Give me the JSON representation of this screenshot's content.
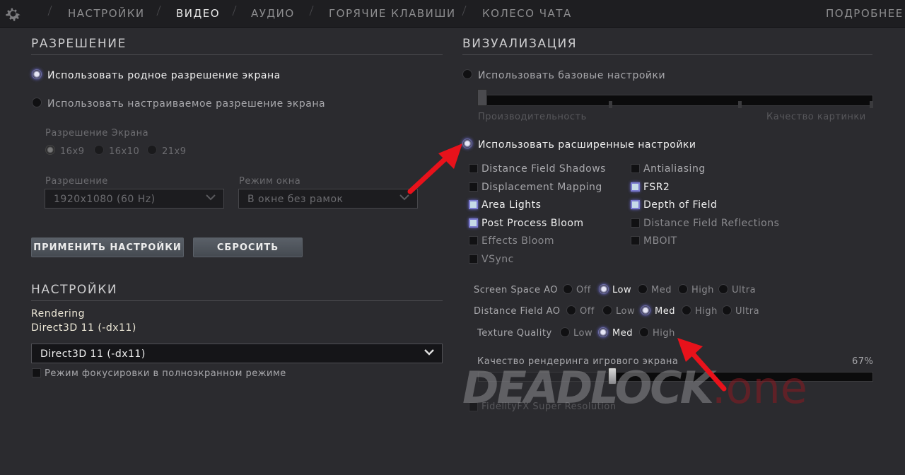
{
  "topbar": {
    "tabs": [
      "НАСТРОЙКИ",
      "ВИДЕО",
      "АУДИО",
      "ГОРЯЧИЕ КЛАВИШИ",
      "КОЛЕСО ЧАТА"
    ],
    "active_tab": "ВИДЕО",
    "more_label": "ПОДРОБНЕЕ"
  },
  "resolution": {
    "title": "РАЗРЕШЕНИЕ",
    "native_label": "Использовать родное разрешение экрана",
    "custom_label": "Использовать настраиваемое разрешение экрана",
    "aspect_label": "Разрешение Экрана",
    "aspects": [
      "16x9",
      "16x10",
      "21x9"
    ],
    "res_label": "Разрешение",
    "res_value": "1920x1080 (60 Hz)",
    "window_label": "Режим окна",
    "window_value": "В окне без рамок",
    "apply_button": "ПРИМЕНИТЬ НАСТРОЙКИ",
    "reset_button": "СБРОСИТЬ"
  },
  "settings": {
    "title": "НАСТРОЙКИ",
    "rendering_label": "Rendering",
    "rendering_value": "Direct3D 11 (-dx11)",
    "renderer_select": "Direct3D 11 (-dx11)",
    "focus_label": "Режим фокусировки в полноэкранном режиме"
  },
  "visualization": {
    "title": "ВИЗУАЛИЗАЦИЯ",
    "basic_label": "Использовать базовые настройки",
    "perf_label": "Производительность",
    "quality_label": "Качество картинки",
    "advanced_label": "Использовать расширенные настройки",
    "checkboxes_left": [
      {
        "label": "Distance Field Shadows",
        "checked": false
      },
      {
        "label": "Displacement Mapping",
        "checked": false
      },
      {
        "label": "Area Lights",
        "checked": true
      },
      {
        "label": "Post Process Bloom",
        "checked": true
      },
      {
        "label": "Effects Bloom",
        "checked": false
      },
      {
        "label": "VSync",
        "checked": false
      }
    ],
    "checkboxes_right": [
      {
        "label": "Antialiasing",
        "checked": false
      },
      {
        "label": "FSR2",
        "checked": true
      },
      {
        "label": "Depth of Field",
        "checked": true
      },
      {
        "label": "Distance Field Reflections",
        "checked": false
      },
      {
        "label": "MBOIT",
        "checked": false
      }
    ],
    "ssao_label": "Screen Space AO",
    "ssao_options": [
      "Off",
      "Low",
      "Med",
      "High",
      "Ultra"
    ],
    "ssao_selected": "Low",
    "dfao_label": "Distance Field AO",
    "dfao_options": [
      "Off",
      "Low",
      "Med",
      "High",
      "Ultra"
    ],
    "dfao_selected": "Med",
    "texture_label": "Texture Quality",
    "texture_options": [
      "Low",
      "Med",
      "High"
    ],
    "texture_selected": "Med",
    "render_quality_label": "Качество рендеринга игрового экрана",
    "render_quality_value": "67%",
    "render_quality_fraction": 0.67,
    "fsr_label": "FidelityFX Super Resolution"
  },
  "watermark": {
    "part1": "DEADLOCK",
    "part2": ".one"
  },
  "colors": {
    "accent": "#7c7cd0",
    "arrow": "#e8121b",
    "bg": "#2b2b2f"
  }
}
